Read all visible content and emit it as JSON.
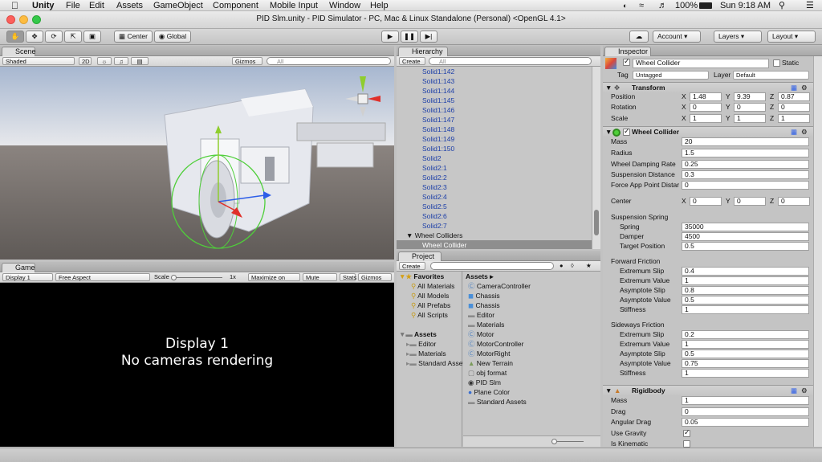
{
  "menubar": {
    "app": "Unity",
    "items": [
      "File",
      "Edit",
      "Assets",
      "GameObject",
      "Component",
      "Mobile Input",
      "Window",
      "Help"
    ],
    "battery": "100%",
    "clock": "Sun 9:18 AM"
  },
  "title": "PID Slm.unity - PID Simulator - PC, Mac & Linux Standalone (Personal) <OpenGL 4.1>",
  "toolbar": {
    "pivot": "Center",
    "space": "Global",
    "account": "Account",
    "layers": "Layers",
    "layout": "Layout"
  },
  "scene": {
    "tab": "Scene",
    "shading": "Shaded",
    "mode2d": "2D",
    "gizmos": "Gizmos",
    "search_placeholder": "All"
  },
  "game": {
    "tab": "Game",
    "display": "Display 1",
    "aspect": "Free Aspect",
    "scale_label": "Scale",
    "scale_value": "1x",
    "maximize": "Maximize on Play",
    "mute": "Mute audio",
    "stats": "Stats",
    "gizmos": "Gizmos",
    "message_line1": "Display 1",
    "message_line2": "No cameras rendering"
  },
  "hierarchy": {
    "tab": "Hierarchy",
    "create": "Create",
    "search_placeholder": "All",
    "items": [
      "Solid1:142",
      "Solid1:143",
      "Solid1:144",
      "Solid1:145",
      "Solid1:146",
      "Solid1:147",
      "Solid1:148",
      "Solid1:149",
      "Solid1:150",
      "Solid2",
      "Solid2:1",
      "Solid2:2",
      "Solid2:3",
      "Solid2:4",
      "Solid2:5",
      "Solid2:6",
      "Solid2:7"
    ],
    "wheel_colliders": "Wheel Colliders",
    "selected": "Wheel Collider"
  },
  "project": {
    "tab": "Project",
    "create": "Create",
    "favorites": "Favorites",
    "fav_items": [
      "All Materials",
      "All Models",
      "All Prefabs",
      "All Scripts"
    ],
    "assets": "Assets",
    "asset_folders": [
      "Editor",
      "Materials",
      "Standard Assets"
    ],
    "breadcrumb": "Assets",
    "files": [
      "CameraController",
      "Chassis",
      "Chassis",
      "Editor",
      "Materials",
      "Motor",
      "MotorController",
      "MotorRight",
      "New Terrain",
      "obj format",
      "PID Slm",
      "Plane Color",
      "Standard Assets"
    ]
  },
  "inspector": {
    "tab": "Inspector",
    "name": "Wheel Collider",
    "static": "Static",
    "tag_label": "Tag",
    "tag": "Untagged",
    "layer_label": "Layer",
    "layer": "Default",
    "transform": {
      "title": "Transform",
      "position": {
        "label": "Position",
        "x": "1.48",
        "y": "9.39",
        "z": "0.87"
      },
      "rotation": {
        "label": "Rotation",
        "x": "0",
        "y": "0",
        "z": "0"
      },
      "scale": {
        "label": "Scale",
        "x": "1",
        "y": "1",
        "z": "1"
      }
    },
    "wheel": {
      "title": "Wheel Collider",
      "mass_label": "Mass",
      "mass": "20",
      "radius_label": "Radius",
      "radius": "1.5",
      "damping_label": "Wheel Damping Rate",
      "damping": "0.25",
      "susp_label": "Suspension Distance",
      "susp": "0.3",
      "force_label": "Force App Point Distar",
      "force": "0",
      "center": {
        "label": "Center",
        "x": "0",
        "y": "0",
        "z": "0"
      },
      "spring_title": "Suspension Spring",
      "spring_label": "Spring",
      "spring": "35000",
      "damper_label": "Damper",
      "damper": "4500",
      "target_label": "Target Position",
      "target": "0.5",
      "fwd_title": "Forward Friction",
      "side_title": "Sideways Friction",
      "ext_slip_label": "Extremum Slip",
      "ext_val_label": "Extremum Value",
      "asym_slip_label": "Asymptote Slip",
      "asym_val_label": "Asymptote Value",
      "stiff_label": "Stiffness",
      "fwd": {
        "ext_slip": "0.4",
        "ext_val": "1",
        "asym_slip": "0.8",
        "asym_val": "0.5",
        "stiff": "1"
      },
      "side": {
        "ext_slip": "0.2",
        "ext_val": "1",
        "asym_slip": "0.5",
        "asym_val": "0.75",
        "stiff": "1"
      }
    },
    "rigidbody": {
      "title": "Rigidbody",
      "mass_label": "Mass",
      "mass": "1",
      "drag_label": "Drag",
      "drag": "0",
      "ang_label": "Angular Drag",
      "ang": "0.05",
      "grav_label": "Use Gravity",
      "kin_label": "Is Kinematic"
    }
  },
  "colors": {
    "selection": "#8e8e8e",
    "hier_text": "#1d3fa8",
    "accent_green": "#4fcf3a",
    "gizmo_y": "#8fcd2e",
    "gizmo_x": "#e0302a",
    "gizmo_z": "#2d5ee8"
  }
}
